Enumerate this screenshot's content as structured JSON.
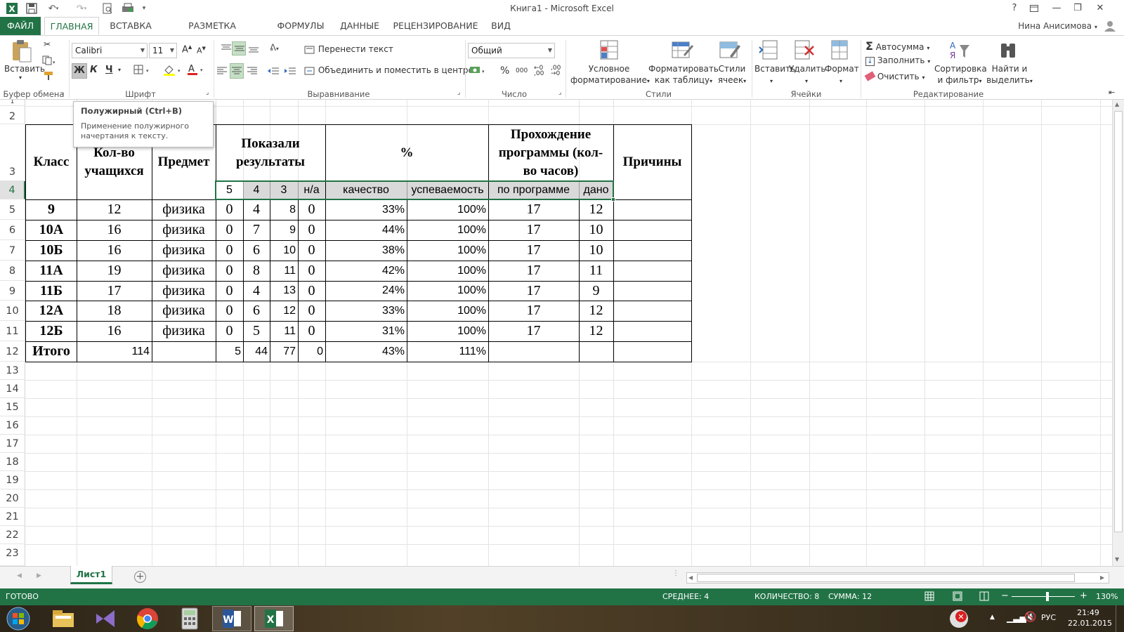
{
  "window": {
    "title": "Книга1 - Microsoft Excel",
    "user_name": "Нина Анисимова",
    "help_label": "?"
  },
  "tabs": [
    {
      "label": "ФАЙЛ"
    },
    {
      "label": "ГЛАВНАЯ"
    },
    {
      "label": "ВСТАВКА"
    },
    {
      "label": "РАЗМЕТКА СТРАНИЦЫ"
    },
    {
      "label": "ФОРМУЛЫ"
    },
    {
      "label": "ДАННЫЕ"
    },
    {
      "label": "РЕЦЕНЗИРОВАНИЕ"
    },
    {
      "label": "ВИД"
    }
  ],
  "ribbon": {
    "clipboard": {
      "paste_label": "Вставить",
      "group_label": "Буфер обмена"
    },
    "font": {
      "name": "Calibri",
      "size": "11",
      "bold": "Ж",
      "italic": "К",
      "underline": "Ч",
      "group_label": "Шрифт"
    },
    "alignment": {
      "wrap_label": "Перенести текст",
      "merge_label": "Объединить и поместить в центре",
      "group_label": "Выравнивание"
    },
    "number": {
      "format": "Общий",
      "percent": "%",
      "thousands": "000",
      "group_label": "Число"
    },
    "styles": {
      "conditional_line1": "Условное",
      "conditional_line2": "форматирование",
      "table_line1": "Форматировать",
      "table_line2": "как таблицу",
      "cell_line1": "Стили",
      "cell_line2": "ячеек",
      "group_label": "Стили"
    },
    "cells": {
      "insert": "Вставить",
      "delete": "Удалить",
      "format": "Формат",
      "group_label": "Ячейки"
    },
    "editing": {
      "autosum": "Автосумма",
      "fill": "Заполнить",
      "clear": "Очистить",
      "sort_line1": "Сортировка",
      "sort_line2": "и фильтр",
      "find_line1": "Найти и",
      "find_line2": "выделить",
      "group_label": "Редактирование"
    }
  },
  "tooltip": {
    "title": "Полужирный (Ctrl+B)",
    "text": "Применение полужирного начертания к тексту."
  },
  "rows": {
    "visible": [
      "1",
      "2",
      "3",
      "4",
      "5",
      "6",
      "7",
      "8",
      "9",
      "10",
      "11",
      "12",
      "13",
      "14",
      "15",
      "16",
      "17",
      "18",
      "19",
      "20",
      "21",
      "22",
      "23"
    ],
    "selected": "4"
  },
  "table": {
    "headers": {
      "class": "Класс",
      "count_line1": "Кол-во",
      "count_line2": "учащихся",
      "subject": "Предмет",
      "shown_line1": "Показали",
      "shown_line2": "результаты",
      "percent": "%",
      "program_line1": "Прохождение",
      "program_line2": "программы (кол-",
      "program_line3": "во часов)",
      "reasons": "Причины"
    },
    "subheaders": [
      "5",
      "4",
      "3",
      "н/а",
      "качество",
      "успеваемость",
      "по программе",
      "дано"
    ],
    "data_rows": [
      {
        "class": "9",
        "count": "12",
        "subject": "физика",
        "g5": "0",
        "g4": "4",
        "g3": "8",
        "na": "0",
        "quality": "33%",
        "success": "100%",
        "prog": "17",
        "given": "12"
      },
      {
        "class": "10А",
        "count": "16",
        "subject": "физика",
        "g5": "0",
        "g4": "7",
        "g3": "9",
        "na": "0",
        "quality": "44%",
        "success": "100%",
        "prog": "17",
        "given": "10"
      },
      {
        "class": "10Б",
        "count": "16",
        "subject": "физика",
        "g5": "0",
        "g4": "6",
        "g3": "10",
        "na": "0",
        "quality": "38%",
        "success": "100%",
        "prog": "17",
        "given": "10"
      },
      {
        "class": "11А",
        "count": "19",
        "subject": "физика",
        "g5": "0",
        "g4": "8",
        "g3": "11",
        "na": "0",
        "quality": "42%",
        "success": "100%",
        "prog": "17",
        "given": "11"
      },
      {
        "class": "11Б",
        "count": "17",
        "subject": "физика",
        "g5": "0",
        "g4": "4",
        "g3": "13",
        "na": "0",
        "quality": "24%",
        "success": "100%",
        "prog": "17",
        "given": "9"
      },
      {
        "class": "12А",
        "count": "18",
        "subject": "физика",
        "g5": "0",
        "g4": "6",
        "g3": "12",
        "na": "0",
        "quality": "33%",
        "success": "100%",
        "prog": "17",
        "given": "12"
      },
      {
        "class": "12Б",
        "count": "16",
        "subject": "физика",
        "g5": "0",
        "g4": "5",
        "g3": "11",
        "na": "0",
        "quality": "31%",
        "success": "100%",
        "prog": "17",
        "given": "12"
      }
    ],
    "total": {
      "class": "Итого",
      "count": "114",
      "g5": "5",
      "g4": "44",
      "g3": "77",
      "na": "0",
      "quality": "43%",
      "success": "111%"
    }
  },
  "sheet_tab": "Лист1",
  "status": {
    "ready": "ГОТОВО",
    "average": "СРЕДНЕЕ: 4",
    "count": "КОЛИЧЕСТВО: 8",
    "sum": "СУММА: 12",
    "zoom": "130%"
  },
  "taskbar": {
    "language": "РУС",
    "time": "21:49",
    "date": "22.01.2015"
  },
  "colors": {
    "excel_green": "#217346",
    "selection_fill": "#d9d9d9"
  }
}
